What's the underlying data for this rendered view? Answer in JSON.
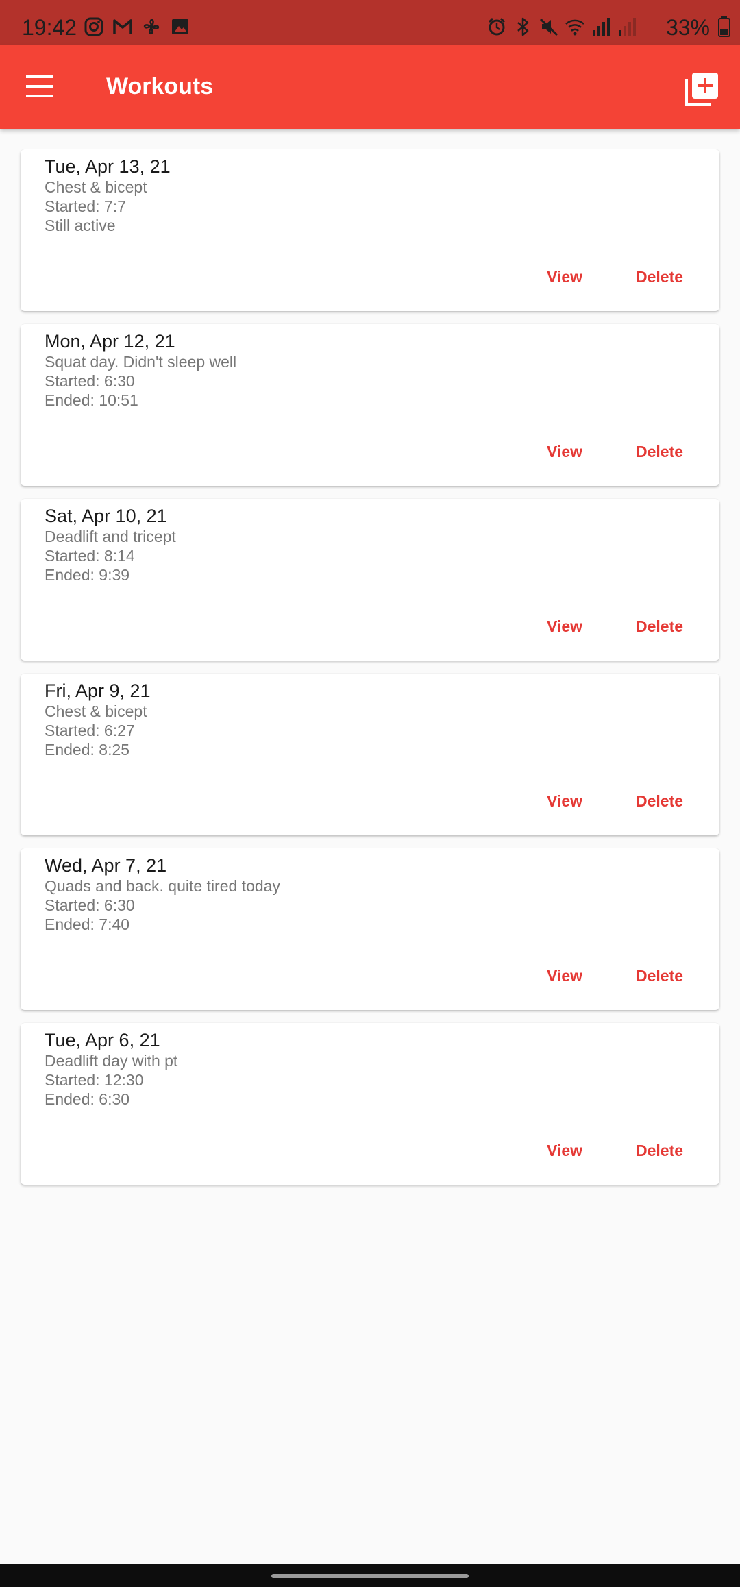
{
  "status_bar": {
    "time": "19:42",
    "battery": "33%",
    "left_icons": [
      "instagram-icon",
      "gmail-icon",
      "fan-icon",
      "gallery-icon"
    ],
    "right_icons": [
      "alarm-icon",
      "bluetooth-icon",
      "mute-icon",
      "wifi-icon",
      "signal-icon",
      "signal-weak-icon"
    ]
  },
  "app_bar": {
    "title": "Workouts",
    "menu_icon": "hamburger-menu-icon",
    "add_icon": "add-box-icon",
    "color": "#f44336"
  },
  "accent_color": "#e53935",
  "workouts": [
    {
      "date": "Tue, Apr 13, 21",
      "note": "Chest & bicept",
      "started": "Started: 7:7",
      "ended": "Still active",
      "view_label": "View",
      "delete_label": "Delete"
    },
    {
      "date": "Mon, Apr 12, 21",
      "note": "Squat day. Didn't sleep well",
      "started": "Started: 6:30",
      "ended": "Ended: 10:51",
      "view_label": "View",
      "delete_label": "Delete"
    },
    {
      "date": "Sat, Apr 10, 21",
      "note": "Deadlift and tricept",
      "started": "Started: 8:14",
      "ended": "Ended: 9:39",
      "view_label": "View",
      "delete_label": "Delete"
    },
    {
      "date": "Fri, Apr 9, 21",
      "note": "Chest & bicept",
      "started": "Started: 6:27",
      "ended": "Ended: 8:25",
      "view_label": "View",
      "delete_label": "Delete"
    },
    {
      "date": "Wed, Apr 7, 21",
      "note": "Quads and back. quite tired today",
      "started": "Started: 6:30",
      "ended": "Ended: 7:40",
      "view_label": "View",
      "delete_label": "Delete"
    },
    {
      "date": "Tue, Apr 6, 21",
      "note": "Deadlift day with pt",
      "started": "Started: 12:30",
      "ended": "Ended: 6:30",
      "view_label": "View",
      "delete_label": "Delete"
    }
  ]
}
